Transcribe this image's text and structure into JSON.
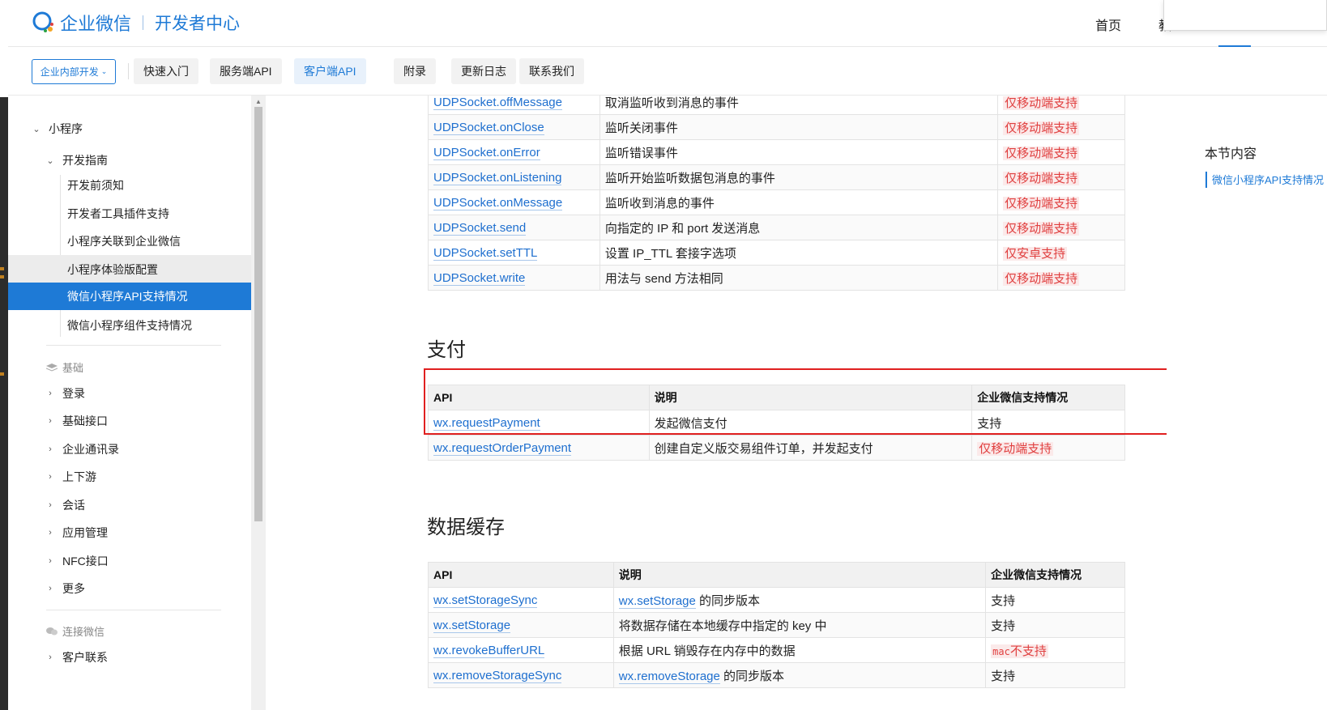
{
  "header": {
    "brand": "企业微信",
    "subtitle": "开发者中心",
    "nav": {
      "home": "首页",
      "tutorial_partial": "教"
    }
  },
  "toolbar": {
    "scope": "企业内部开发",
    "tabs": [
      "快速入门",
      "服务端API",
      "客户端API",
      "附录",
      "更新日志",
      "联系我们"
    ],
    "active_tab": "客户端API"
  },
  "sidebar": {
    "root": "小程序",
    "sub": "开发指南",
    "leaves": [
      "开发前须知",
      "开发者工具插件支持",
      "小程序关联到企业微信",
      "小程序体验版配置",
      "微信小程序API支持情况",
      "微信小程序组件支持情况"
    ],
    "group1": "基础",
    "group1_items": [
      "登录",
      "基础接口",
      "企业通讯录",
      "上下游",
      "会话",
      "应用管理",
      "NFC接口",
      "更多"
    ],
    "group2": "连接微信",
    "group2_items": [
      "客户联系"
    ]
  },
  "udp_rows": [
    {
      "api": "UDPSocket.offMessage",
      "desc": "取消监听收到消息的事件",
      "support": "仅移动端支持"
    },
    {
      "api": "UDPSocket.onClose",
      "desc": "监听关闭事件",
      "support": "仅移动端支持"
    },
    {
      "api": "UDPSocket.onError",
      "desc": "监听错误事件",
      "support": "仅移动端支持"
    },
    {
      "api": "UDPSocket.onListening",
      "desc": "监听开始监听数据包消息的事件",
      "support": "仅移动端支持"
    },
    {
      "api": "UDPSocket.onMessage",
      "desc": "监听收到消息的事件",
      "support": "仅移动端支持"
    },
    {
      "api": "UDPSocket.send",
      "desc": "向指定的 IP 和 port 发送消息",
      "support": "仅移动端支持"
    },
    {
      "api": "UDPSocket.setTTL",
      "desc": "设置 IP_TTL 套接字选项",
      "support": "仅安卓支持"
    },
    {
      "api": "UDPSocket.write",
      "desc": "用法与 send 方法相同",
      "support": "仅移动端支持"
    }
  ],
  "pay": {
    "title": "支付",
    "headers": [
      "API",
      "说明",
      "企业微信支持情况"
    ],
    "rows": [
      {
        "api": "wx.requestPayment",
        "desc": "发起微信支付",
        "support": "支持"
      },
      {
        "api": "wx.requestOrderPayment",
        "desc": "创建自定义版交易组件订单，并发起支付",
        "support": "仅移动端支持"
      }
    ]
  },
  "cache": {
    "title": "数据缓存",
    "headers": [
      "API",
      "说明",
      "企业微信支持情况"
    ],
    "rows": [
      {
        "api": "wx.setStorageSync",
        "desc_link": "wx.setStorage",
        "desc": " 的同步版本",
        "support": "支持"
      },
      {
        "api": "wx.setStorage",
        "desc": "将数据存储在本地缓存中指定的 key 中",
        "support": "支持"
      },
      {
        "api": "wx.revokeBufferURL",
        "desc": "根据 URL 销毁存在内存中的数据",
        "support_code": "mac",
        "support": "不支持"
      },
      {
        "api": "wx.removeStorageSync",
        "desc_link": "wx.removeStorage",
        "desc": " 的同步版本",
        "support": "支持"
      }
    ]
  },
  "toc": {
    "title": "本节内容",
    "item": "微信小程序API支持情况"
  },
  "colors": {
    "accent": "#1e7ad6",
    "warn": "#e04040",
    "highlight_box": "#e02020"
  }
}
